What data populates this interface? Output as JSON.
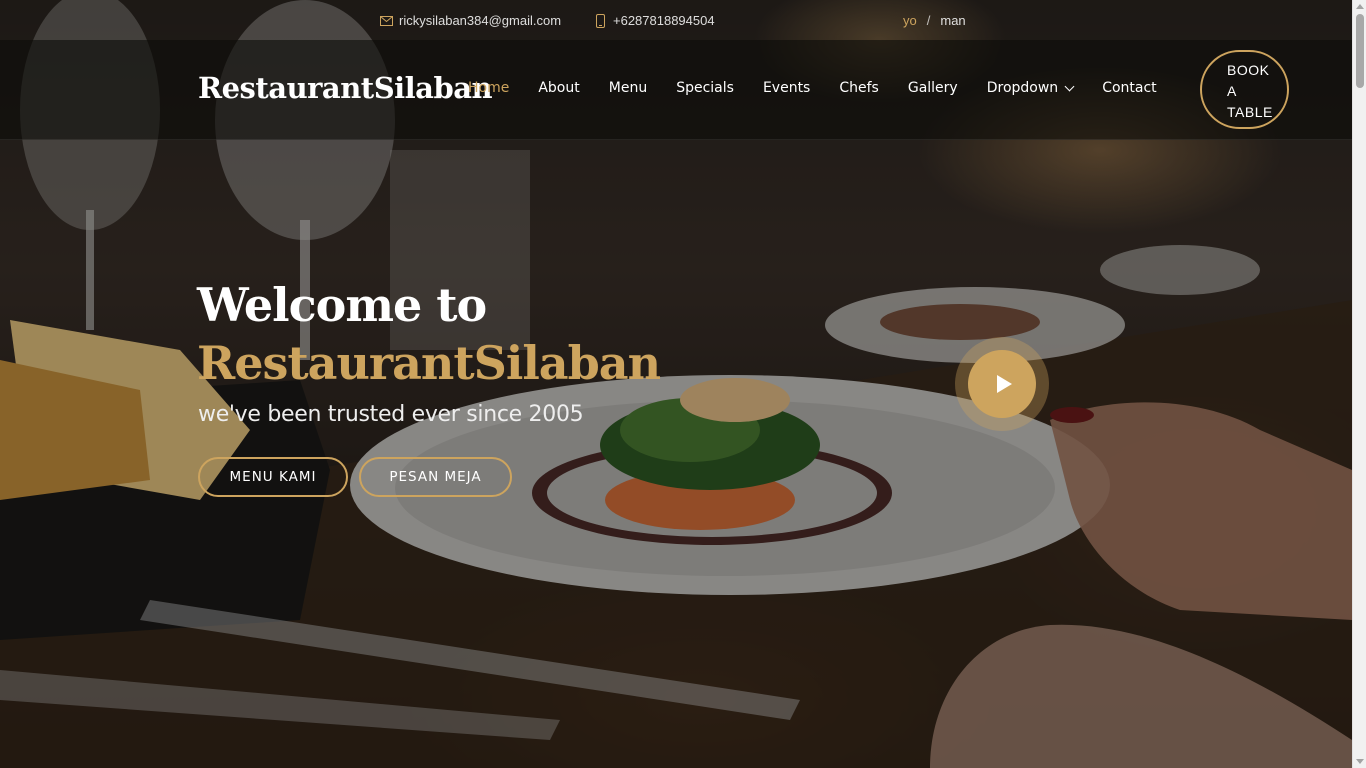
{
  "topbar": {
    "email": "rickysilaban384@gmail.com",
    "phone": "+6287818894504",
    "lang_active": "yo",
    "lang_separator": "/",
    "lang_other": "man"
  },
  "header": {
    "logo": "RestaurantSilaban",
    "nav": [
      {
        "label": "Home"
      },
      {
        "label": "About"
      },
      {
        "label": "Menu"
      },
      {
        "label": "Specials"
      },
      {
        "label": "Events"
      },
      {
        "label": "Chefs"
      },
      {
        "label": "Gallery"
      },
      {
        "label": "Dropdown"
      },
      {
        "label": "Contact"
      }
    ],
    "book_line1": "BOOK",
    "book_line2": "A",
    "book_line3": "TABLE"
  },
  "hero": {
    "title_line1": "Welcome to",
    "title_brand": "RestaurantSilaban",
    "subtitle": "we've been trusted ever since 2005",
    "btn_menu": "MENU KAMI",
    "btn_book": "PESAN MEJA"
  },
  "colors": {
    "accent": "#cda45e",
    "header_bg": "#0c0b09"
  }
}
